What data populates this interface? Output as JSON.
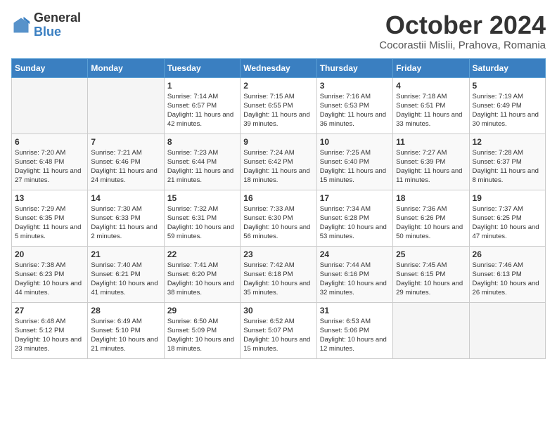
{
  "logo": {
    "general": "General",
    "blue": "Blue"
  },
  "header": {
    "month": "October 2024",
    "location": "Cocorastii Mislii, Prahova, Romania"
  },
  "weekdays": [
    "Sunday",
    "Monday",
    "Tuesday",
    "Wednesday",
    "Thursday",
    "Friday",
    "Saturday"
  ],
  "weeks": [
    [
      {
        "date": "",
        "sunrise": "",
        "sunset": "",
        "daylight": ""
      },
      {
        "date": "",
        "sunrise": "",
        "sunset": "",
        "daylight": ""
      },
      {
        "date": "1",
        "sunrise": "Sunrise: 7:14 AM",
        "sunset": "Sunset: 6:57 PM",
        "daylight": "Daylight: 11 hours and 42 minutes."
      },
      {
        "date": "2",
        "sunrise": "Sunrise: 7:15 AM",
        "sunset": "Sunset: 6:55 PM",
        "daylight": "Daylight: 11 hours and 39 minutes."
      },
      {
        "date": "3",
        "sunrise": "Sunrise: 7:16 AM",
        "sunset": "Sunset: 6:53 PM",
        "daylight": "Daylight: 11 hours and 36 minutes."
      },
      {
        "date": "4",
        "sunrise": "Sunrise: 7:18 AM",
        "sunset": "Sunset: 6:51 PM",
        "daylight": "Daylight: 11 hours and 33 minutes."
      },
      {
        "date": "5",
        "sunrise": "Sunrise: 7:19 AM",
        "sunset": "Sunset: 6:49 PM",
        "daylight": "Daylight: 11 hours and 30 minutes."
      }
    ],
    [
      {
        "date": "6",
        "sunrise": "Sunrise: 7:20 AM",
        "sunset": "Sunset: 6:48 PM",
        "daylight": "Daylight: 11 hours and 27 minutes."
      },
      {
        "date": "7",
        "sunrise": "Sunrise: 7:21 AM",
        "sunset": "Sunset: 6:46 PM",
        "daylight": "Daylight: 11 hours and 24 minutes."
      },
      {
        "date": "8",
        "sunrise": "Sunrise: 7:23 AM",
        "sunset": "Sunset: 6:44 PM",
        "daylight": "Daylight: 11 hours and 21 minutes."
      },
      {
        "date": "9",
        "sunrise": "Sunrise: 7:24 AM",
        "sunset": "Sunset: 6:42 PM",
        "daylight": "Daylight: 11 hours and 18 minutes."
      },
      {
        "date": "10",
        "sunrise": "Sunrise: 7:25 AM",
        "sunset": "Sunset: 6:40 PM",
        "daylight": "Daylight: 11 hours and 15 minutes."
      },
      {
        "date": "11",
        "sunrise": "Sunrise: 7:27 AM",
        "sunset": "Sunset: 6:39 PM",
        "daylight": "Daylight: 11 hours and 11 minutes."
      },
      {
        "date": "12",
        "sunrise": "Sunrise: 7:28 AM",
        "sunset": "Sunset: 6:37 PM",
        "daylight": "Daylight: 11 hours and 8 minutes."
      }
    ],
    [
      {
        "date": "13",
        "sunrise": "Sunrise: 7:29 AM",
        "sunset": "Sunset: 6:35 PM",
        "daylight": "Daylight: 11 hours and 5 minutes."
      },
      {
        "date": "14",
        "sunrise": "Sunrise: 7:30 AM",
        "sunset": "Sunset: 6:33 PM",
        "daylight": "Daylight: 11 hours and 2 minutes."
      },
      {
        "date": "15",
        "sunrise": "Sunrise: 7:32 AM",
        "sunset": "Sunset: 6:31 PM",
        "daylight": "Daylight: 10 hours and 59 minutes."
      },
      {
        "date": "16",
        "sunrise": "Sunrise: 7:33 AM",
        "sunset": "Sunset: 6:30 PM",
        "daylight": "Daylight: 10 hours and 56 minutes."
      },
      {
        "date": "17",
        "sunrise": "Sunrise: 7:34 AM",
        "sunset": "Sunset: 6:28 PM",
        "daylight": "Daylight: 10 hours and 53 minutes."
      },
      {
        "date": "18",
        "sunrise": "Sunrise: 7:36 AM",
        "sunset": "Sunset: 6:26 PM",
        "daylight": "Daylight: 10 hours and 50 minutes."
      },
      {
        "date": "19",
        "sunrise": "Sunrise: 7:37 AM",
        "sunset": "Sunset: 6:25 PM",
        "daylight": "Daylight: 10 hours and 47 minutes."
      }
    ],
    [
      {
        "date": "20",
        "sunrise": "Sunrise: 7:38 AM",
        "sunset": "Sunset: 6:23 PM",
        "daylight": "Daylight: 10 hours and 44 minutes."
      },
      {
        "date": "21",
        "sunrise": "Sunrise: 7:40 AM",
        "sunset": "Sunset: 6:21 PM",
        "daylight": "Daylight: 10 hours and 41 minutes."
      },
      {
        "date": "22",
        "sunrise": "Sunrise: 7:41 AM",
        "sunset": "Sunset: 6:20 PM",
        "daylight": "Daylight: 10 hours and 38 minutes."
      },
      {
        "date": "23",
        "sunrise": "Sunrise: 7:42 AM",
        "sunset": "Sunset: 6:18 PM",
        "daylight": "Daylight: 10 hours and 35 minutes."
      },
      {
        "date": "24",
        "sunrise": "Sunrise: 7:44 AM",
        "sunset": "Sunset: 6:16 PM",
        "daylight": "Daylight: 10 hours and 32 minutes."
      },
      {
        "date": "25",
        "sunrise": "Sunrise: 7:45 AM",
        "sunset": "Sunset: 6:15 PM",
        "daylight": "Daylight: 10 hours and 29 minutes."
      },
      {
        "date": "26",
        "sunrise": "Sunrise: 7:46 AM",
        "sunset": "Sunset: 6:13 PM",
        "daylight": "Daylight: 10 hours and 26 minutes."
      }
    ],
    [
      {
        "date": "27",
        "sunrise": "Sunrise: 6:48 AM",
        "sunset": "Sunset: 5:12 PM",
        "daylight": "Daylight: 10 hours and 23 minutes."
      },
      {
        "date": "28",
        "sunrise": "Sunrise: 6:49 AM",
        "sunset": "Sunset: 5:10 PM",
        "daylight": "Daylight: 10 hours and 21 minutes."
      },
      {
        "date": "29",
        "sunrise": "Sunrise: 6:50 AM",
        "sunset": "Sunset: 5:09 PM",
        "daylight": "Daylight: 10 hours and 18 minutes."
      },
      {
        "date": "30",
        "sunrise": "Sunrise: 6:52 AM",
        "sunset": "Sunset: 5:07 PM",
        "daylight": "Daylight: 10 hours and 15 minutes."
      },
      {
        "date": "31",
        "sunrise": "Sunrise: 6:53 AM",
        "sunset": "Sunset: 5:06 PM",
        "daylight": "Daylight: 10 hours and 12 minutes."
      },
      {
        "date": "",
        "sunrise": "",
        "sunset": "",
        "daylight": ""
      },
      {
        "date": "",
        "sunrise": "",
        "sunset": "",
        "daylight": ""
      }
    ]
  ]
}
